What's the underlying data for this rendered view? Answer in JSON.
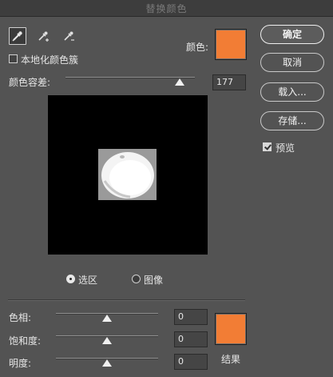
{
  "window": {
    "title": "替换颜色"
  },
  "tools": [
    {
      "name": "eyedropper-icon",
      "active": true
    },
    {
      "name": "eyedropper-plus-icon",
      "active": false
    },
    {
      "name": "eyedropper-minus-icon",
      "active": false
    }
  ],
  "selection": {
    "localized_clusters_label": "本地化颜色簇",
    "localized_clusters_checked": false,
    "color_label": "颜色:",
    "color_hex": "#f27d35",
    "fuzziness_label": "颜色容差:",
    "fuzziness_value": "177",
    "fuzziness_level": 177,
    "fuzziness_max": 200
  },
  "preview_mode": {
    "selection_label": "选区",
    "image_label": "图像",
    "selected": "selection"
  },
  "replacement": {
    "hue_label": "色相:",
    "hue_value": "0",
    "hue_level": 0,
    "saturation_label": "饱和度:",
    "saturation_value": "0",
    "saturation_level": 0,
    "lightness_label": "明度:",
    "lightness_value": "0",
    "lightness_level": 0,
    "result_label": "结果",
    "result_hex": "#f27d35"
  },
  "buttons": {
    "ok": "确定",
    "cancel": "取消",
    "load": "载入...",
    "save": "存储..."
  },
  "preview_option": {
    "label": "预览",
    "checked": true
  }
}
